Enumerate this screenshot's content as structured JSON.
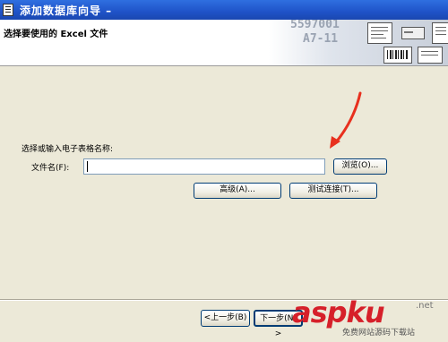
{
  "window": {
    "title": "添加数据库向导 –"
  },
  "header": {
    "title": "选择要使用的 Excel 文件",
    "art_numbers": [
      "5597001",
      "A7-11"
    ]
  },
  "content": {
    "prompt": "选择或输入电子表格名称:",
    "file_label": "文件名(F):",
    "file_value": "",
    "browse_label": "浏览(O)...",
    "advanced_label": "高级(A)...",
    "test_label": "测试连接(T)..."
  },
  "footer": {
    "back_label": "<上一步(B)",
    "next_label": "下一步(N) >"
  },
  "watermark": {
    "brand": "aspku",
    "net": ".net",
    "sub": "免费网站源码下载站"
  },
  "colors": {
    "titlebar": "#1f53c8",
    "dialog_bg": "#ece9d8",
    "watermark": "#d6202a",
    "arrow": "#e8301e"
  }
}
